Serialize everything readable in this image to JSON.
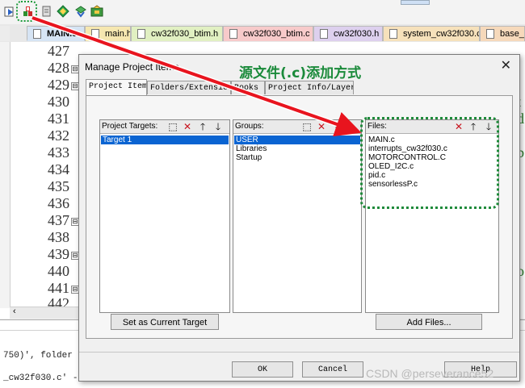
{
  "tabs": [
    {
      "label": "MAIN.c",
      "color": "#d6e4f4",
      "active": true
    },
    {
      "label": "main.h",
      "color": "#f6e7b0"
    },
    {
      "label": "cw32f030_btim.h",
      "color": "#e1f0c2"
    },
    {
      "label": "cw32f030_btim.c",
      "color": "#f7caca"
    },
    {
      "label": "cw32f030.h",
      "color": "#ddd0ee"
    },
    {
      "label": "system_cw32f030.c",
      "color": "#f6e1bb"
    },
    {
      "label": "base_t",
      "color": "#f6d9bb"
    }
  ],
  "editor": {
    "line_numbers": [
      "427",
      "428",
      "429",
      "430",
      "431",
      "432",
      "433",
      "434",
      "435",
      "436",
      "437",
      "438",
      "439",
      "440",
      "441",
      "442"
    ],
    "fold_markers": [
      "⊟",
      "⊟",
      "⊟",
      "⊟",
      "⊟"
    ],
    "right_glyphs": [
      "t",
      "d",
      "b",
      "o"
    ]
  },
  "output": {
    "line1": "750)', folder",
    "line2": "_cw32f030.c' -"
  },
  "dialog": {
    "title": "Manage Project Items",
    "close": "✕",
    "tabs": [
      "Project Items",
      "Folders/Extensions",
      "Books",
      "Project Info/Layer"
    ],
    "targets": {
      "header": "Project Targets:",
      "items": [
        "Target 1"
      ],
      "selected": 0
    },
    "groups": {
      "header": "Groups:",
      "items": [
        "USER",
        "Libraries",
        "Startup"
      ],
      "selected": 0
    },
    "files": {
      "header": "Files:",
      "items": [
        "MAIN.c",
        "interrupts_cw32f030.c",
        "MOTORCONTROL.C",
        "OLED_I2C.c",
        "pid.c",
        "sensorlessP.c"
      ]
    },
    "buttons": {
      "set_target": "Set as Current Target",
      "add_files": "Add Files...",
      "ok": "OK",
      "cancel": "Cancel",
      "help": "Help"
    },
    "icons": {
      "new": "new-item-icon",
      "delete": "delete-icon",
      "up": "move-up-icon",
      "down": "move-down-icon"
    }
  },
  "annotation": {
    "text": "源文件(.c)添加方式",
    "color": "#1a8a3a"
  },
  "watermark": "CSDN @perseverance52",
  "colors": {
    "selection": "#0a64d2",
    "arrow": "#e8141e",
    "ring": "#1e8a3a"
  }
}
